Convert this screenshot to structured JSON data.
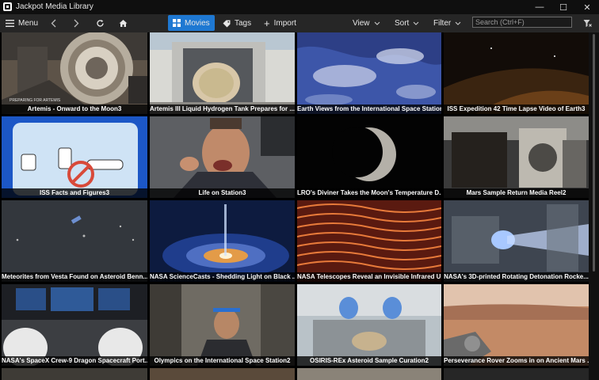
{
  "window": {
    "title": "Jackpot Media Library",
    "minimize": "—",
    "maximize": "☐",
    "close": "✕"
  },
  "toolbar": {
    "menu_label": "Menu",
    "back_icon": "chevron-left",
    "forward_icon": "chevron-right",
    "movies_label": "Movies",
    "tags_label": "Tags",
    "import_label": "Import",
    "view_label": "View",
    "sort_label": "Sort",
    "filter_label": "Filter",
    "search_placeholder": "Search (Ctrl+F)"
  },
  "movies": [
    {
      "title": "Artemis - Onward to the Moon3",
      "overlay": "PREPARING FOR ARTEMIS"
    },
    {
      "title": "Artemis III Liquid Hydrogen Tank Prepares for ..."
    },
    {
      "title": "Earth Views from the International Space Station..."
    },
    {
      "title": "ISS Expedition 42 Time Lapse Video of Earth3"
    },
    {
      "title": "ISS Facts and Figures3"
    },
    {
      "title": "Life on Station3"
    },
    {
      "title": "LRO's Diviner Takes the Moon's Temperature D..."
    },
    {
      "title": "Mars Sample Return Media Reel2"
    },
    {
      "title": "Meteorites from Vesta Found on Asteroid Benn..."
    },
    {
      "title": "NASA ScienceCasts - Shedding Light on Black ..."
    },
    {
      "title": "NASA Telescopes Reveal an Invisible Infrared U..."
    },
    {
      "title": "NASA's 3D-printed Rotating Detonation Rocke..."
    },
    {
      "title": "NASA's SpaceX Crew-9 Dragon Spacecraft Port..."
    },
    {
      "title": "Olympics on the International Space Station2"
    },
    {
      "title": "OSIRIS-REx Asteroid Sample Curation2"
    },
    {
      "title": "Perseverance Rover Zooms in on Ancient Mars ..."
    }
  ]
}
